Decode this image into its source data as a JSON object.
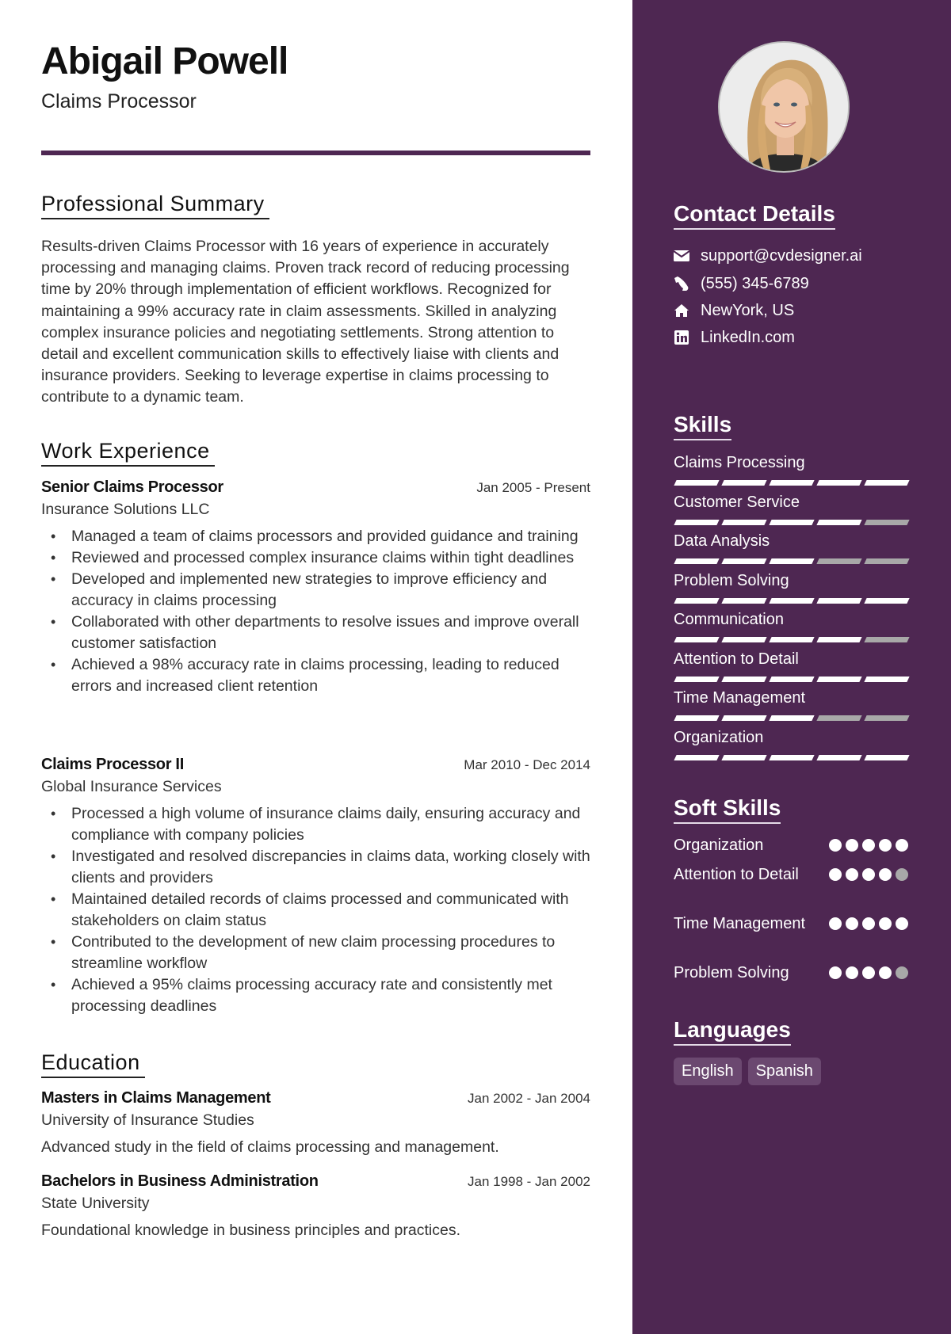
{
  "header": {
    "name": "Abigail Powell",
    "role": "Claims Processor"
  },
  "colors": {
    "accent": "#4e2752",
    "skill_on": "#ffffff",
    "skill_off": "#a8a8a8",
    "tag_bg": "#6b4870"
  },
  "summary": {
    "title": "Professional Summary",
    "text": "Results-driven Claims Processor with 16 years of experience in accurately processing and managing claims. Proven track record of reducing processing time by 20% through implementation of efficient workflows. Recognized for maintaining a 99% accuracy rate in claim assessments. Skilled in analyzing complex insurance policies and negotiating settlements. Strong attention to detail and excellent communication skills to effectively liaise with clients and insurance providers. Seeking to leverage expertise in claims processing to contribute to a dynamic team."
  },
  "experience": {
    "title": "Work Experience",
    "jobs": [
      {
        "title": "Senior Claims Processor",
        "date": "Jan 2005 - Present",
        "org": "Insurance Solutions LLC",
        "bullets": [
          "Managed a team of claims processors and provided guidance and training",
          "Reviewed and processed complex insurance claims within tight deadlines",
          "Developed and implemented new strategies to improve efficiency and accuracy in claims processing",
          "Collaborated with other departments to resolve issues and improve overall customer satisfaction",
          "Achieved a 98% accuracy rate in claims processing, leading to reduced errors and increased client retention"
        ]
      },
      {
        "title": "Claims Processor II",
        "date": "Mar 2010 - Dec 2014",
        "org": "Global Insurance Services",
        "bullets": [
          "Processed a high volume of insurance claims daily, ensuring accuracy and compliance with company policies",
          "Investigated and resolved discrepancies in claims data, working closely with clients and providers",
          "Maintained detailed records of claims processed and communicated with stakeholders on claim status",
          "Contributed to the development of new claim processing procedures to streamline workflow",
          "Achieved a 95% claims processing accuracy rate and consistently met processing deadlines"
        ]
      }
    ]
  },
  "education": {
    "title": "Education",
    "items": [
      {
        "degree": "Masters in Claims Management",
        "date": "Jan 2002 - Jan 2004",
        "school": "University of Insurance Studies",
        "desc": "Advanced study in the field of claims processing and management."
      },
      {
        "degree": "Bachelors in Business Administration",
        "date": "Jan 1998 - Jan 2002",
        "school": "State University",
        "desc": "Foundational knowledge in business principles and practices."
      }
    ]
  },
  "sidebar": {
    "photo_alt": "Profile photo of Abigail Powell",
    "contact": {
      "title": "Contact Details",
      "items": [
        {
          "icon": "envelope-icon",
          "text": "support@cvdesigner.ai"
        },
        {
          "icon": "phone-icon",
          "text": "(555) 345-6789"
        },
        {
          "icon": "home-icon",
          "text": "NewYork, US"
        },
        {
          "icon": "linkedin-icon",
          "text": "LinkedIn.com"
        }
      ]
    },
    "skills": {
      "title": "Skills",
      "max": 5,
      "items": [
        {
          "label": "Claims Processing",
          "level": 5
        },
        {
          "label": "Customer Service",
          "level": 4
        },
        {
          "label": "Data Analysis",
          "level": 3
        },
        {
          "label": "Problem Solving",
          "level": 5
        },
        {
          "label": "Communication",
          "level": 4
        },
        {
          "label": "Attention to Detail",
          "level": 5
        },
        {
          "label": "Time Management",
          "level": 3
        },
        {
          "label": "Organization",
          "level": 5
        }
      ]
    },
    "soft_skills": {
      "title": "Soft Skills",
      "max": 5,
      "items": [
        {
          "label": "Organization",
          "level": 5
        },
        {
          "label": "Attention to Detail",
          "level": 4
        },
        {
          "label": "Time Management",
          "level": 5
        },
        {
          "label": "Problem Solving",
          "level": 4
        }
      ]
    },
    "languages": {
      "title": "Languages",
      "items": [
        "English",
        "Spanish"
      ]
    }
  }
}
